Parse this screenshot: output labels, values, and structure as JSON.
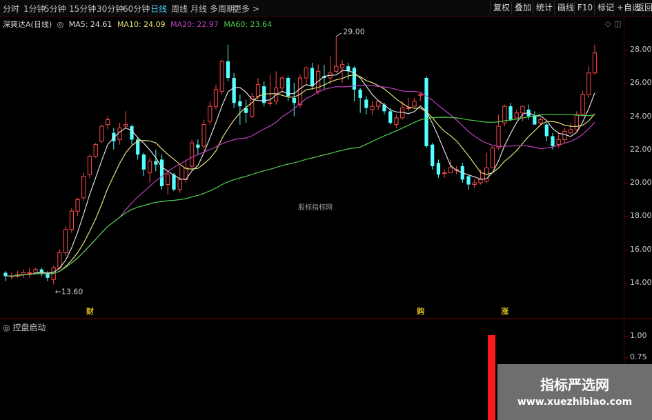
{
  "toolbar": {
    "periods": [
      "分时",
      "1分钟",
      "5分钟",
      "15分钟",
      "30分钟",
      "60分钟",
      "日线",
      "周线",
      "月线",
      "多周期",
      "更多 >"
    ],
    "active_period": "日线",
    "buttons": [
      "复权",
      "叠加",
      "统计",
      "画线",
      "F10",
      "标记",
      "+自选",
      "返回"
    ]
  },
  "legend": {
    "stock": "深爽达A(日线)",
    "ma5": "MA5: 24.61",
    "ma10": "MA10: 24.09",
    "ma20": "MA20: 22.97",
    "ma60": "MA60: 23.64"
  },
  "colors": {
    "up": "#ff4a4a",
    "down": "#54ffff",
    "ma5": "#e0e0e0",
    "ma10": "#e8e07a",
    "ma20": "#c040c0",
    "ma60": "#50d050",
    "event": "#e0c020"
  },
  "annotations": {
    "high": "29.00",
    "low": "13.60",
    "center_watermark": "股标指标网"
  },
  "events": [
    {
      "label": "财",
      "date_index": 14
    },
    {
      "label": "购",
      "date_index": 69
    },
    {
      "label": "涨",
      "date_index": 83
    }
  ],
  "indicator": {
    "title": "控盘启动",
    "ticks": [
      "1.00",
      "0.75"
    ],
    "bar_value": 1.0
  },
  "watermark": {
    "line1": "指标严选网",
    "line2": "www.xuezhibiao.com"
  },
  "chart_data": {
    "type": "candlestick",
    "y_ticks": [
      "28.00",
      "26.00",
      "24.00",
      "22.00",
      "20.00",
      "18.00",
      "16.00",
      "14.00"
    ],
    "ylim": [
      13.0,
      28.8
    ],
    "candles": [
      [
        14.6,
        14.4,
        14.7,
        14.1
      ],
      [
        14.4,
        14.4,
        14.6,
        14.2
      ],
      [
        14.4,
        14.5,
        14.7,
        14.3
      ],
      [
        14.5,
        14.6,
        14.8,
        14.3
      ],
      [
        14.6,
        14.6,
        14.9,
        14.3
      ],
      [
        14.6,
        14.8,
        14.9,
        14.5
      ],
      [
        14.8,
        14.6,
        14.9,
        14.4
      ],
      [
        14.6,
        14.3,
        14.7,
        14.1
      ],
      [
        14.2,
        14.9,
        15.0,
        13.9
      ],
      [
        14.9,
        15.8,
        16.0,
        14.8
      ],
      [
        15.8,
        17.2,
        17.4,
        15.6
      ],
      [
        17.2,
        18.3,
        18.5,
        17.0
      ],
      [
        18.3,
        19.0,
        19.1,
        18.0
      ],
      [
        19.1,
        20.4,
        20.6,
        18.9
      ],
      [
        20.5,
        21.6,
        21.7,
        20.3
      ],
      [
        21.6,
        22.3,
        22.4,
        21.5
      ],
      [
        22.5,
        23.4,
        23.5,
        22.4
      ],
      [
        23.5,
        23.8,
        24.0,
        23.2
      ],
      [
        23.0,
        22.5,
        23.3,
        22.0
      ],
      [
        22.6,
        23.3,
        23.6,
        22.3
      ],
      [
        23.4,
        23.5,
        24.3,
        23.3
      ],
      [
        23.4,
        22.6,
        23.5,
        22.3
      ],
      [
        22.6,
        21.7,
        22.7,
        21.4
      ],
      [
        21.7,
        20.8,
        21.8,
        20.4
      ],
      [
        20.6,
        21.3,
        21.5,
        20.0
      ],
      [
        21.3,
        21.1,
        22.0,
        20.7
      ],
      [
        21.4,
        19.8,
        21.7,
        19.6
      ],
      [
        19.9,
        20.5,
        20.7,
        19.3
      ],
      [
        20.5,
        19.6,
        20.6,
        19.5
      ],
      [
        19.6,
        20.2,
        21.0,
        19.4
      ],
      [
        20.2,
        20.9,
        21.4,
        20.0
      ],
      [
        21.0,
        22.4,
        22.6,
        20.8
      ],
      [
        22.3,
        22.1,
        22.6,
        21.7
      ],
      [
        22.2,
        23.5,
        23.8,
        22.0
      ],
      [
        23.7,
        24.6,
        24.9,
        23.5
      ],
      [
        24.6,
        25.6,
        25.9,
        24.4
      ],
      [
        25.5,
        27.3,
        27.4,
        25.3
      ],
      [
        27.3,
        26.3,
        28.3,
        26.1
      ],
      [
        26.3,
        24.8,
        26.6,
        24.5
      ],
      [
        24.9,
        24.6,
        25.3,
        23.5
      ],
      [
        24.5,
        24.2,
        25.0,
        23.6
      ],
      [
        24.0,
        25.2,
        25.4,
        23.9
      ],
      [
        25.2,
        25.9,
        26.3,
        25.0
      ],
      [
        25.8,
        24.8,
        26.1,
        24.6
      ],
      [
        24.8,
        24.8,
        26.5,
        24.6
      ],
      [
        24.9,
        25.7,
        26.7,
        24.7
      ],
      [
        25.7,
        26.3,
        26.4,
        25.4
      ],
      [
        26.3,
        25.2,
        26.4,
        24.9
      ],
      [
        25.1,
        24.8,
        26.0,
        24.0
      ],
      [
        24.7,
        26.3,
        26.5,
        24.5
      ],
      [
        26.3,
        26.9,
        27.0,
        25.9
      ],
      [
        26.9,
        25.8,
        27.2,
        25.6
      ],
      [
        25.5,
        26.7,
        27.1,
        25.3
      ],
      [
        26.4,
        26.3,
        27.1,
        25.6
      ],
      [
        26.3,
        26.6,
        27.6,
        25.9
      ],
      [
        26.7,
        27.0,
        28.8,
        26.6
      ],
      [
        26.9,
        27.1,
        27.4,
        26.0
      ],
      [
        27.0,
        26.7,
        27.2,
        26.2
      ],
      [
        26.9,
        25.6,
        27.0,
        24.9
      ],
      [
        25.6,
        25.1,
        25.7,
        24.2
      ],
      [
        25.0,
        24.5,
        25.2,
        24.1
      ],
      [
        24.4,
        24.6,
        24.9,
        24.1
      ],
      [
        24.6,
        24.9,
        25.0,
        24.4
      ],
      [
        24.7,
        24.3,
        24.8,
        24.1
      ],
      [
        24.3,
        23.6,
        24.5,
        23.5
      ],
      [
        23.5,
        23.9,
        24.1,
        23.3
      ],
      [
        23.9,
        24.5,
        24.9,
        23.8
      ],
      [
        24.5,
        24.5,
        25.1,
        24.3
      ],
      [
        24.6,
        24.9,
        25.1,
        24.6
      ],
      [
        25.3,
        25.3,
        25.4,
        24.9
      ],
      [
        26.3,
        22.2,
        26.4,
        22.1
      ],
      [
        22.3,
        21.0,
        22.4,
        20.8
      ],
      [
        21.2,
        20.5,
        21.4,
        20.3
      ],
      [
        20.6,
        20.6,
        20.8,
        20.3
      ],
      [
        20.6,
        20.9,
        21.4,
        20.6
      ],
      [
        20.8,
        20.8,
        21.0,
        20.5
      ],
      [
        21.0,
        20.2,
        21.2,
        20.0
      ],
      [
        20.4,
        19.9,
        20.5,
        19.6
      ],
      [
        19.9,
        20.0,
        20.2,
        19.7
      ],
      [
        20.0,
        20.2,
        20.8,
        19.9
      ],
      [
        20.1,
        20.9,
        21.8,
        20.0
      ],
      [
        20.9,
        22.1,
        22.2,
        20.9
      ],
      [
        22.1,
        23.4,
        24.1,
        22.0
      ],
      [
        23.6,
        24.6,
        24.7,
        23.4
      ],
      [
        24.6,
        23.8,
        24.8,
        23.7
      ],
      [
        23.9,
        24.2,
        24.4,
        23.9
      ],
      [
        24.2,
        24.6,
        24.6,
        23.7
      ],
      [
        24.4,
        24.0,
        24.7,
        23.8
      ],
      [
        24.0,
        23.5,
        24.3,
        23.5
      ],
      [
        23.6,
        23.8,
        23.9,
        23.5
      ],
      [
        23.5,
        22.8,
        23.6,
        22.5
      ],
      [
        22.8,
        22.2,
        23.0,
        22.0
      ],
      [
        22.3,
        22.6,
        23.0,
        22.1
      ],
      [
        22.6,
        23.1,
        23.3,
        22.4
      ],
      [
        23.0,
        23.2,
        23.6,
        22.9
      ],
      [
        23.2,
        24.1,
        24.3,
        23.1
      ],
      [
        24.1,
        25.3,
        25.5,
        24.0
      ],
      [
        25.3,
        26.6,
        27.0,
        25.1
      ],
      [
        26.6,
        27.8,
        28.3,
        26.5
      ]
    ],
    "x_range": [
      0,
      99
    ]
  }
}
